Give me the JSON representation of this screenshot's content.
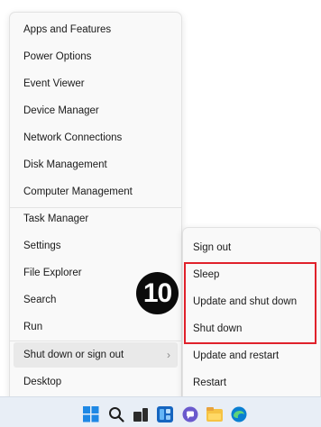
{
  "context_menu": {
    "items": [
      {
        "label": "Apps and Features"
      },
      {
        "label": "Power Options"
      },
      {
        "label": "Event Viewer"
      },
      {
        "label": "Device Manager"
      },
      {
        "label": "Network Connections"
      },
      {
        "label": "Disk Management"
      },
      {
        "label": "Computer Management"
      },
      {
        "label": "Task Manager"
      },
      {
        "label": "Settings"
      },
      {
        "label": "File Explorer"
      },
      {
        "label": "Search"
      },
      {
        "label": "Run"
      },
      {
        "label": "Shut down or sign out",
        "has_submenu": true,
        "highlighted": true
      },
      {
        "label": "Desktop"
      }
    ]
  },
  "submenu": {
    "items": [
      {
        "label": "Sign out"
      },
      {
        "label": "Sleep"
      },
      {
        "label": "Update and shut down"
      },
      {
        "label": "Shut down"
      },
      {
        "label": "Update and restart"
      },
      {
        "label": "Restart"
      }
    ]
  },
  "annotation": {
    "step_number": "10",
    "box_color": "#e0212b"
  },
  "taskbar": {
    "icons": [
      "windows-start-icon",
      "search-icon",
      "task-view-icon",
      "widgets-icon",
      "teams-chat-icon",
      "file-explorer-icon",
      "edge-icon"
    ]
  },
  "colors": {
    "menu_background": "#f9f9f9",
    "menu_highlight": "#e9e9e9",
    "taskbar_background": "#e8eef6",
    "accent_blue": "#1e88e5"
  }
}
